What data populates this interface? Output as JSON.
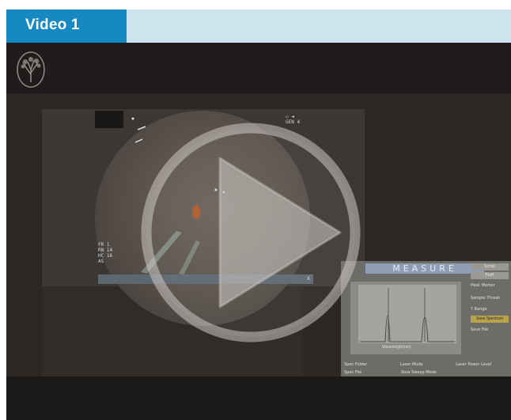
{
  "header": {
    "title": "Video 1",
    "tab_color": "#1688c2",
    "bar_color": "#cde3ee"
  },
  "video": {
    "play_icon": "play-icon",
    "logo_icon": "tree-logo-icon",
    "scope": {
      "top_right_lines": [
        "▭ ◄",
        "",
        "GEN 4"
      ],
      "bottom_left_lines": [
        "FR 1",
        "RN 14",
        "HC 16",
        "AS"
      ]
    },
    "status_bar": {
      "close_glyph": "x"
    },
    "measure_panel": {
      "title": "MEASURE",
      "side_buttons": [
        "Scroll",
        "Fluff"
      ],
      "side_labels": [
        "Peak Marker",
        "Sample Thresh",
        "Y Range",
        "Save File"
      ],
      "side_yellow": [
        "Save Spectrum"
      ],
      "x_axis_label": "Wavelength(nm)",
      "bottom_rows": [
        [
          "Spec Folder",
          "Laser Mode",
          "Laser Power Level"
        ],
        [
          "Spec File",
          "Slow Sweep Mode"
        ]
      ]
    }
  }
}
